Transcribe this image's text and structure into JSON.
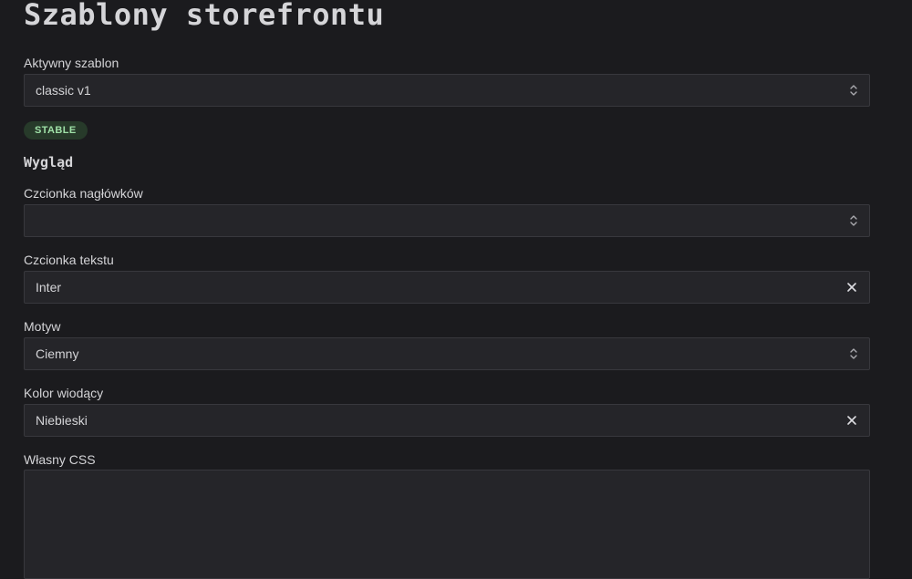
{
  "page": {
    "title": "Szablony storefrontu"
  },
  "template_select": {
    "label": "Aktywny szablon",
    "value": "classic v1",
    "icon": "chevron-up-down-icon"
  },
  "status_badge": {
    "text": "STABLE",
    "color": "#9fe0a7"
  },
  "appearance": {
    "title": "Wygląd",
    "heading_font": {
      "label": "Czcionka nagłówków",
      "value": "",
      "icon": "chevron-up-down-icon"
    },
    "body_font": {
      "label": "Czcionka tekstu",
      "value": "Inter",
      "icon": "close-icon"
    },
    "theme": {
      "label": "Motyw",
      "value": "Ciemny",
      "icon": "chevron-up-down-icon"
    },
    "accent_color": {
      "label": "Kolor wiodący",
      "value": "Niebieski",
      "icon": "close-icon"
    },
    "custom_css": {
      "label": "Własny CSS",
      "value": ""
    }
  }
}
